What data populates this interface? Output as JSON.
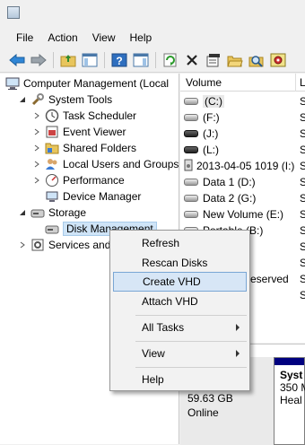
{
  "menu": [
    "File",
    "Action",
    "View",
    "Help"
  ],
  "tree": {
    "root": "Computer Management (Local",
    "system_tools": "System Tools",
    "task_scheduler": "Task Scheduler",
    "event_viewer": "Event Viewer",
    "shared_folders": "Shared Folders",
    "local_users": "Local Users and Groups",
    "performance": "Performance",
    "device_manager": "Device Manager",
    "storage": "Storage",
    "disk_management": "Disk Management",
    "services": "Services and A"
  },
  "list": {
    "header": "Volume",
    "header2": "L",
    "volumes": [
      {
        "label": "(C:)",
        "s": "S"
      },
      {
        "label": "(F:)",
        "s": "S"
      },
      {
        "label": "(J:)",
        "s": "S"
      },
      {
        "label": "(L:)",
        "s": "S"
      },
      {
        "label": "2013-04-05 1019 (I:)",
        "s": "S"
      },
      {
        "label": "Data 1 (D:)",
        "s": "S"
      },
      {
        "label": "Data 2 (G:)",
        "s": "S"
      },
      {
        "label": "New Volume (E:)",
        "s": "S"
      },
      {
        "label": "Portable (B:)",
        "s": "S"
      },
      {
        "label": "",
        "s": "S"
      },
      {
        "label": "",
        "s": "S"
      },
      {
        "label": "eserved",
        "s": "S"
      },
      {
        "label": "",
        "s": "S"
      }
    ]
  },
  "disk": {
    "size": "59.63 GB",
    "status": "Online",
    "part_name": "Syst",
    "part_size": "350 M",
    "part_health": "Heal"
  },
  "context_menu": {
    "refresh": "Refresh",
    "rescan": "Rescan Disks",
    "create_vhd": "Create VHD",
    "attach_vhd": "Attach VHD",
    "all_tasks": "All Tasks",
    "view": "View",
    "help": "Help"
  }
}
